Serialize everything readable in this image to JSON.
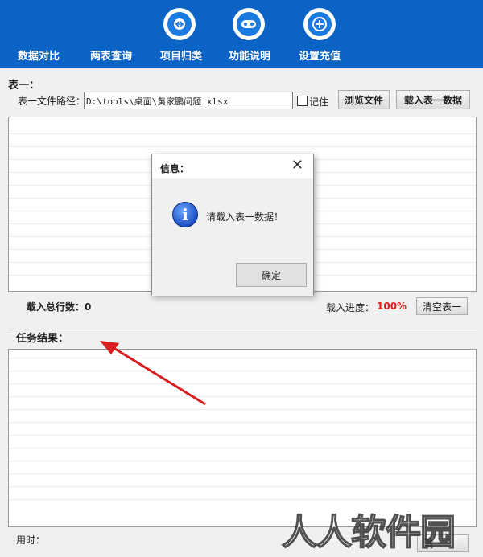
{
  "toolbar": {
    "items": [
      {
        "label": "数据对比",
        "icon": "compare-icon"
      },
      {
        "label": "两表查询",
        "icon": "query-icon"
      },
      {
        "label": "项目归类",
        "icon": "classify-icon"
      },
      {
        "label": "功能说明",
        "icon": "gamepad-icon"
      },
      {
        "label": "设置充值",
        "icon": "plus-icon"
      }
    ],
    "bg_color": "#0b63c6"
  },
  "table1": {
    "group_title": "表一：",
    "path_label": "表一文件路径：",
    "path_value": "D:\\tools\\桌面\\黄家鹏问题.xlsx",
    "remember_label": "记住",
    "browse_button": "浏览文件",
    "load_button": "载入表一数据",
    "total_rows_label": "载入总行数：0",
    "progress_label": "载入进度：",
    "progress_value": "100%",
    "clear_button": "清空表一"
  },
  "results": {
    "group_title": "任务结果：",
    "time_label": "用时：",
    "clear_button_partial": "清"
  },
  "dialog": {
    "title": "信息：",
    "message": "请载入表一数据！",
    "ok_button": "确定",
    "icon": "info-icon"
  },
  "watermark": "人人软件园"
}
